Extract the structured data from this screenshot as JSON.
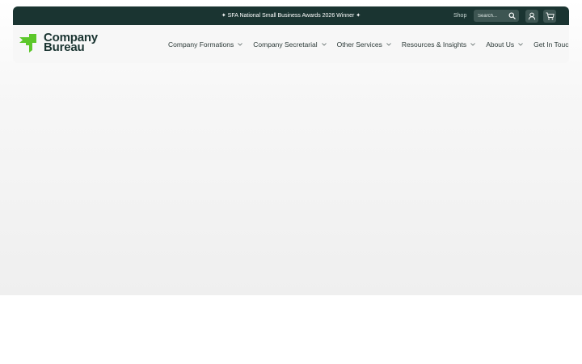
{
  "colors": {
    "topbar": "#1a3431",
    "brand_green": "#5cc72a",
    "header_bg": "#f7f7f7"
  },
  "topbar": {
    "announcement": "✦ SFA National Small Business Awards 2026 Winner ✦",
    "shop_label": "Shop",
    "search_placeholder": "Search...",
    "icons": [
      "search-icon",
      "user-icon",
      "cart-icon"
    ]
  },
  "logo": {
    "line1": "Company",
    "line2": "Bureau"
  },
  "nav": {
    "items": [
      {
        "label": "Company Formations",
        "has_dropdown": true
      },
      {
        "label": "Company Secretarial",
        "has_dropdown": true
      },
      {
        "label": "Other Services",
        "has_dropdown": true
      },
      {
        "label": "Resources & Insights",
        "has_dropdown": true
      },
      {
        "label": "About Us",
        "has_dropdown": true
      },
      {
        "label": "Get In Touch",
        "has_dropdown": false
      }
    ]
  }
}
